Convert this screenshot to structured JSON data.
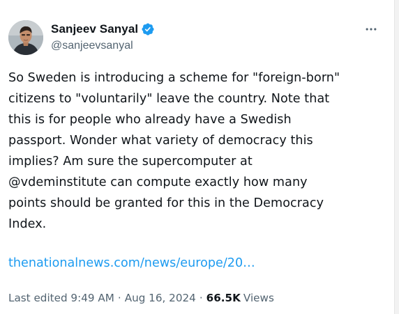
{
  "author": {
    "display_name": "Sanjeev Sanyal",
    "handle": "@sanjeevsanyal",
    "avatar_icon": "person-avatar",
    "verified_icon": "verified-badge-icon",
    "verified_color": "#1d9bf0"
  },
  "menu": {
    "more_icon": "more-horizontal-icon"
  },
  "tweet": {
    "text": "So Sweden is introducing a scheme for \"foreign-born\"\ncitizens to \"voluntarily\" leave the country. Note that\nthis is for people who already have a Swedish\npassport. Wonder what variety of democracy this\nimplies? Am sure the supercomputer at\n@vdeminstitute can compute exactly how many\npoints should be granted for this in the Democracy\nIndex.",
    "link": "thenationalnews.com/news/europe/20…",
    "link_color": "#1d9bf0"
  },
  "meta": {
    "edited_time": "Last edited 9:49 AM",
    "separator": "·",
    "date": "Aug 16, 2024",
    "views_count": "66.5K",
    "views_label": "Views"
  }
}
